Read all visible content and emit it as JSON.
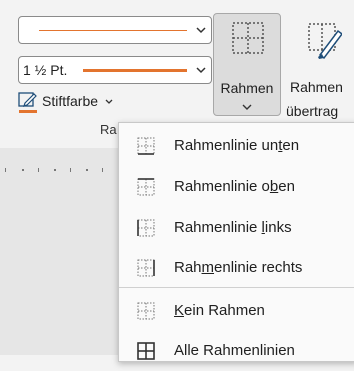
{
  "ribbon": {
    "pen_weight": "1 ½ Pt.",
    "pen_color_label": "Stiftfarbe",
    "borders_label": "Rahmen",
    "painter_label_line1": "Rahmen",
    "painter_label_line2": "übertrag",
    "group_label_partial": "Ra"
  },
  "menu": {
    "items": [
      {
        "pre": "Rahmenlinie un",
        "key": "t",
        "post": "en",
        "icon": "border-bottom-icon"
      },
      {
        "pre": "Rahmenlinie o",
        "key": "b",
        "post": "en",
        "icon": "border-top-icon"
      },
      {
        "pre": "Rahmenlinie ",
        "key": "l",
        "post": "inks",
        "icon": "border-left-icon"
      },
      {
        "pre": "Rah",
        "key": "m",
        "post": "enlinie rechts",
        "icon": "border-right-icon"
      },
      {
        "pre": "",
        "key": "K",
        "post": "ein Rahmen",
        "icon": "no-border-icon"
      },
      {
        "pre": "Alle Rahmenlinien",
        "key": "",
        "post": "",
        "icon": "all-borders-icon"
      }
    ]
  },
  "colors": {
    "pen_color": "#e3742e",
    "accent": "#1f4e79"
  }
}
